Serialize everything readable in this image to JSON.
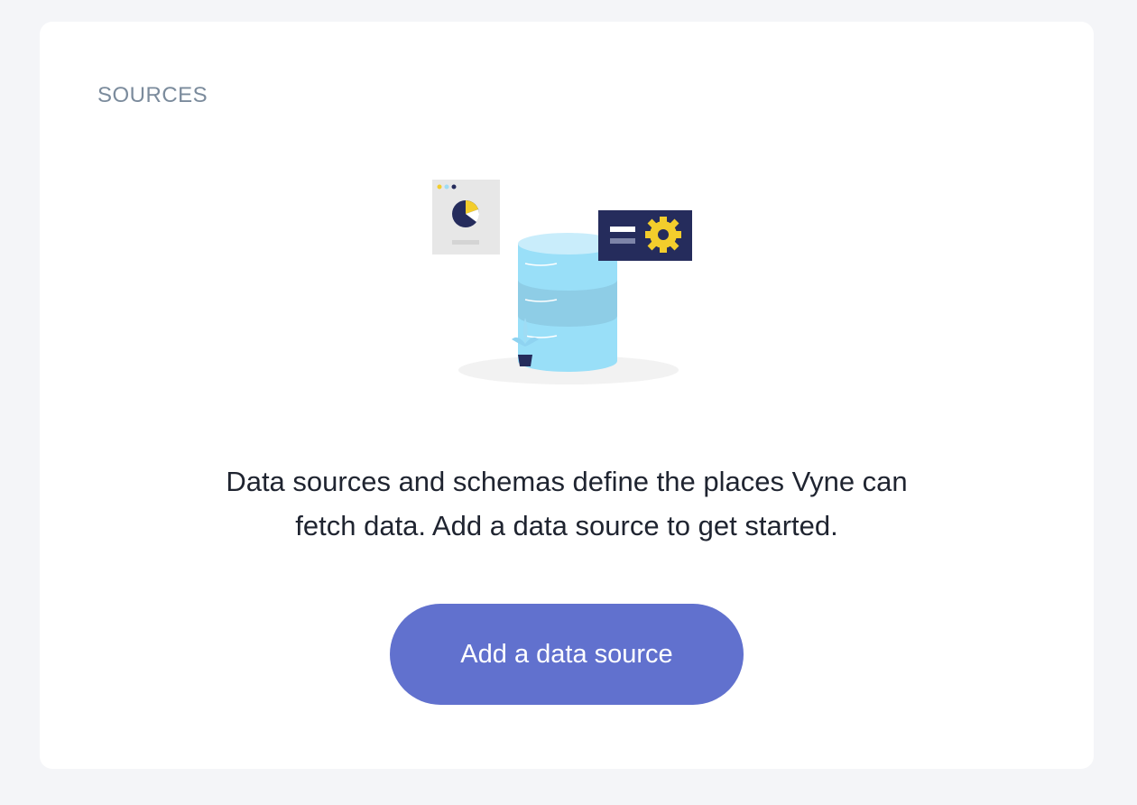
{
  "sources_card": {
    "title": "SOURCES",
    "empty_state_message": "Data sources and schemas define the places Vyne can fetch data. Add a data source to get started.",
    "add_button_label": "Add a data source"
  },
  "colors": {
    "page_background": "#f4f5f8",
    "card_background": "#ffffff",
    "title_text": "#7b8b9c",
    "body_text": "#1f2430",
    "button_background": "#6171ce",
    "button_text": "#ffffff",
    "illustration_database": "#99dff8",
    "illustration_navy": "#252c5c",
    "illustration_yellow": "#f3cd2c"
  },
  "illustration": {
    "name": "database-illustration",
    "elements": [
      "chart-report-icon",
      "database-icon",
      "settings-panel-icon",
      "plant-icon"
    ]
  }
}
